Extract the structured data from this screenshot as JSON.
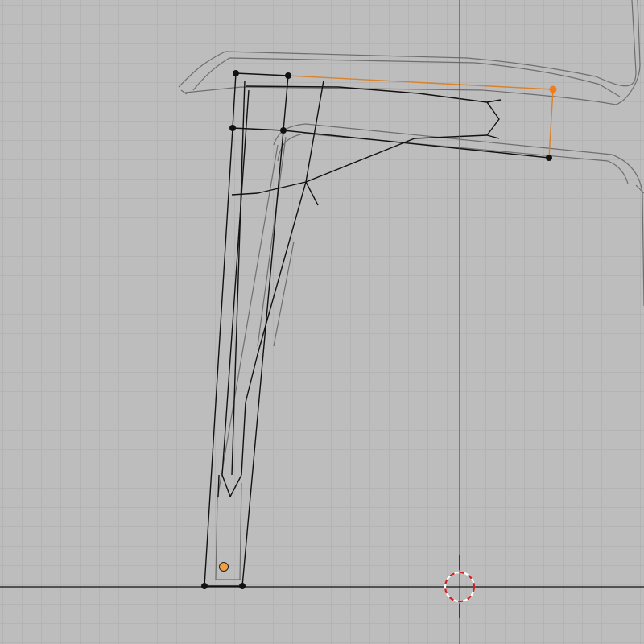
{
  "viewport": {
    "view": "orthographic-side",
    "colors": {
      "background": "#bdbdbd",
      "grid_minor": "#acacac",
      "grid_major": "#a3a3a3",
      "axis_vertical": "#2f5f9e",
      "axis_horizontal": "#111111",
      "ghost_mesh": "#6e6e6e",
      "edges": "#111111",
      "selected_edge": "#d9822b",
      "active_vertex": "#f07c1c",
      "origin_dot": "#f0a040",
      "cursor_red": "#d02020",
      "cursor_white": "#ffffff"
    },
    "icons": [
      "3d-cursor-icon",
      "object-origin-icon"
    ]
  }
}
